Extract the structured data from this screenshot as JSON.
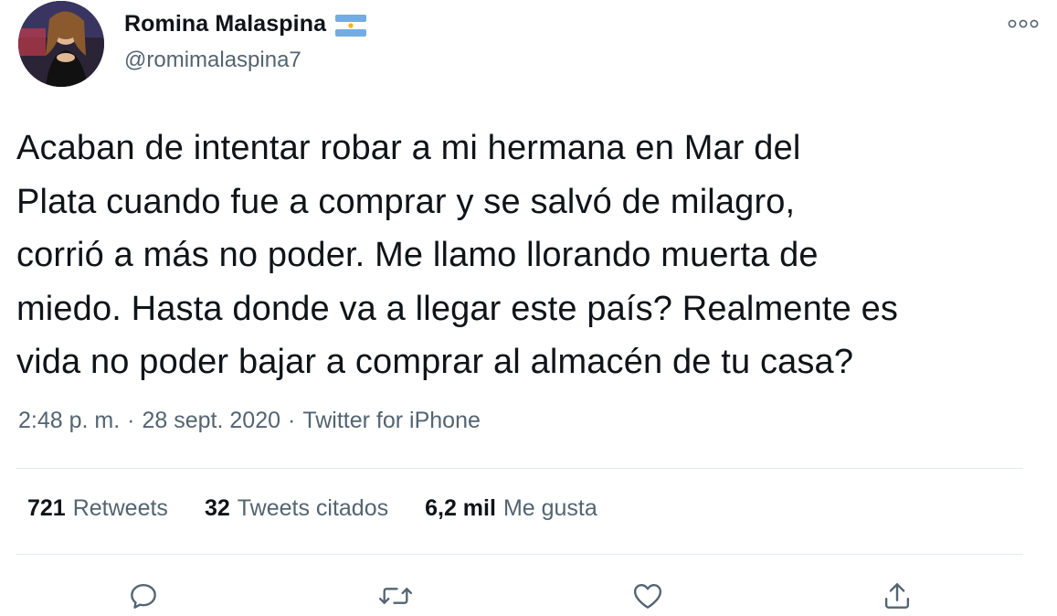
{
  "user": {
    "display_name": "Romina Malaspina",
    "handle": "@romimalaspina7",
    "flag_icon": "argentina-flag-icon"
  },
  "tweet": {
    "text": "Acaban de intentar robar a mi hermana en Mar del\nPlata cuando fue a comprar y se salvó de milagro,\ncorrió a más no poder. Me llamo llorando muerta de\nmiedo. Hasta donde va a llegar este país? Realmente es\nvida no poder bajar a comprar al almacén de tu casa?",
    "time": "2:48 p. m.",
    "separator": "·",
    "date": "28 sept. 2020",
    "source": "Twitter for iPhone"
  },
  "stats": {
    "retweets_count": "721",
    "retweets_label": "Retweets",
    "quotes_count": "32",
    "quotes_label": "Tweets citados",
    "likes_count": "6,2 mil",
    "likes_label": "Me gusta"
  },
  "actions": {
    "reply_icon": "reply-icon",
    "retweet_icon": "retweet-icon",
    "like_icon": "heart-icon",
    "share_icon": "share-icon",
    "more_icon": "more-icon"
  },
  "colors": {
    "text": "#0f1419",
    "secondary": "#536471",
    "divider": "#e1e8ed",
    "flag_blue": "#74acdf"
  }
}
